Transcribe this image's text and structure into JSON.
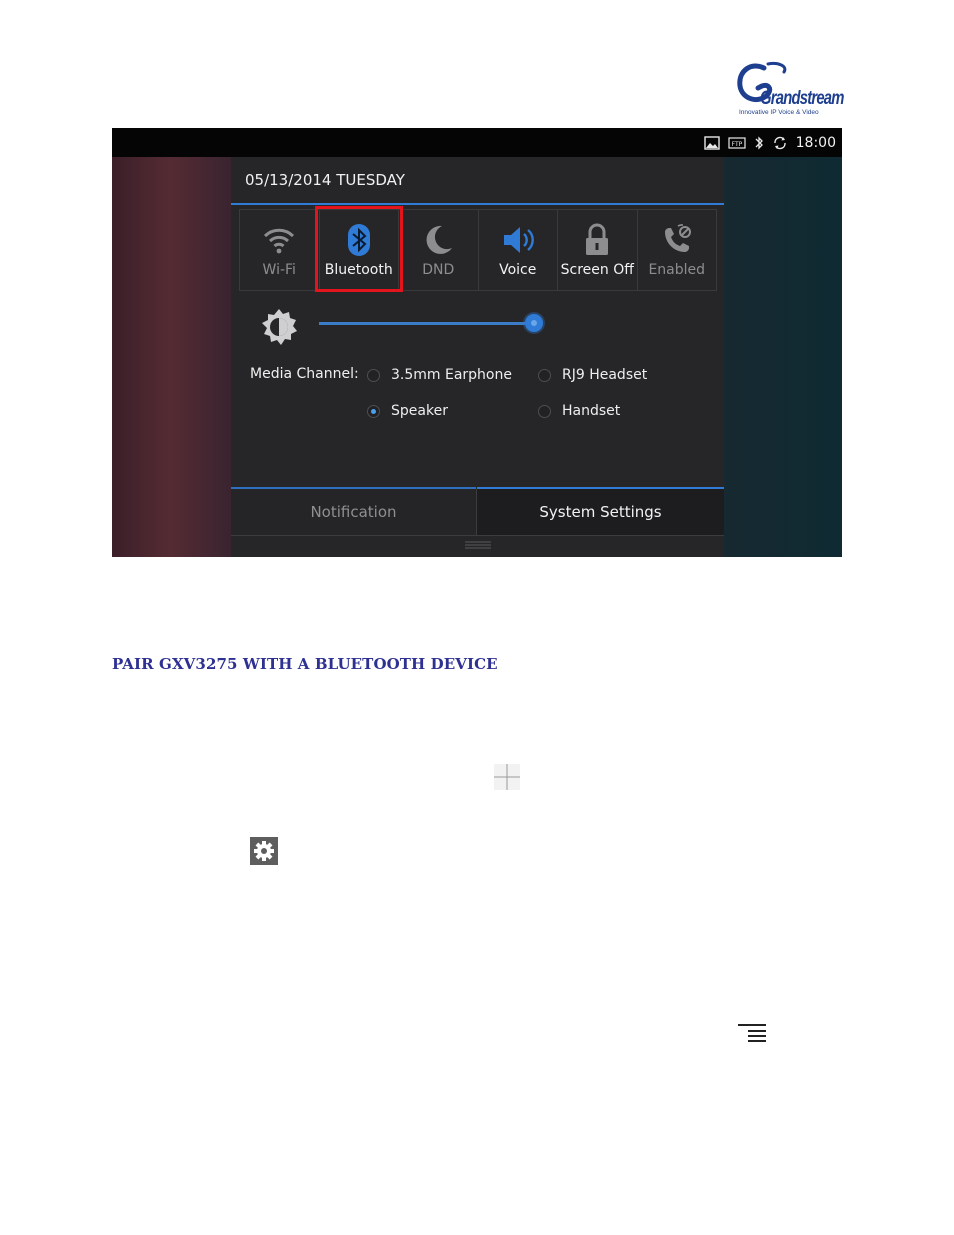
{
  "logo": {
    "brand": "Grandstream",
    "tagline": "Innovative IP Voice & Video",
    "color": "#1e3f8f"
  },
  "screenshot": {
    "statusbar": {
      "icons": [
        "image-icon",
        "ftp-icon",
        "bluetooth-icon",
        "sync-icon"
      ],
      "ftp_label": "FTP",
      "time": "18:00"
    },
    "panel": {
      "date": "05/13/2014 TUESDAY",
      "tiles": [
        {
          "label": "Wi-Fi",
          "icon": "wifi-icon",
          "active": false
        },
        {
          "label": "Bluetooth",
          "icon": "bluetooth-icon",
          "active": true
        },
        {
          "label": "DND",
          "icon": "moon-icon",
          "active": false
        },
        {
          "label": "Voice",
          "icon": "speaker-icon",
          "active": true
        },
        {
          "label": "Screen Off",
          "icon": "lock-icon",
          "active": true
        },
        {
          "label": "Enabled",
          "icon": "phone-icon",
          "active": false
        }
      ],
      "highlighted_tile": "Bluetooth",
      "highlight_color": "#e4141c",
      "brightness_level": 1.0,
      "media_channel": {
        "label": "Media Channel:",
        "options": [
          {
            "label": "3.5mm Earphone",
            "selected": false
          },
          {
            "label": "RJ9 Headset",
            "selected": false
          },
          {
            "label": "Speaker",
            "selected": true
          },
          {
            "label": "Handset",
            "selected": false
          }
        ]
      },
      "tabs": [
        {
          "label": "Notification",
          "active": false
        },
        {
          "label": "System Settings",
          "active": true
        }
      ]
    },
    "accent_color": "#2f7bd6"
  },
  "section_heading": "PAIR GXV3275 WITH A BLUETOOTH DEVICE",
  "heading_color": "#2e3192",
  "inline_icons": [
    "apps-icon",
    "settings-icon",
    "menu-icon"
  ]
}
